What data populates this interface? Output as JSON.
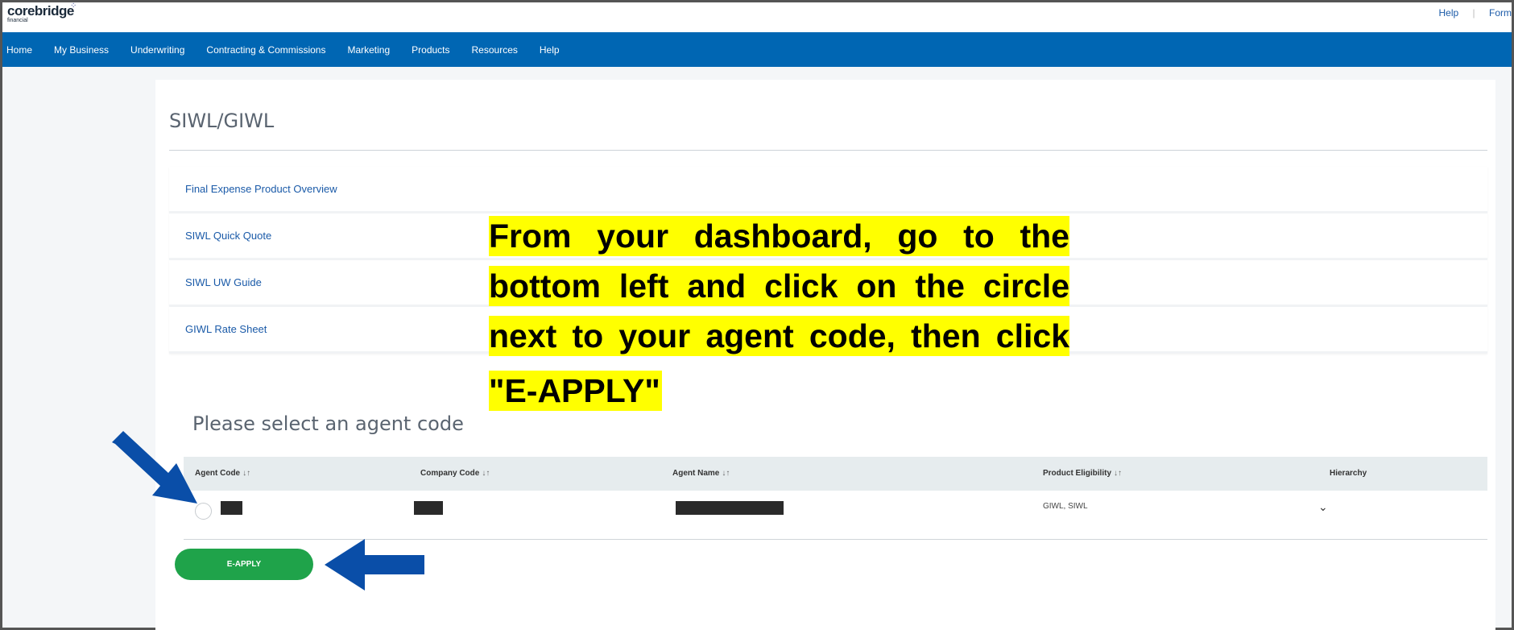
{
  "header": {
    "logo_text": "corebridge",
    "logo_sub": "financial",
    "top_links": [
      "Help",
      "Form"
    ]
  },
  "nav": {
    "items": [
      "Home",
      "My Business",
      "Underwriting",
      "Contracting & Commissions",
      "Marketing",
      "Products",
      "Resources",
      "Help"
    ]
  },
  "page": {
    "title": "SIWL/GIWL",
    "links": [
      "Final Expense Product Overview",
      "SIWL Quick Quote",
      "SIWL UW Guide",
      "GIWL Rate Sheet"
    ],
    "select_heading": "Please select an agent code"
  },
  "table": {
    "headers": {
      "agent_code": "Agent Code",
      "company_code": "Company Code",
      "agent_name": "Agent Name",
      "product_eligibility": "Product Eligibility",
      "hierarchy": "Hierarchy"
    },
    "sort_glyph": "↓↑",
    "row": {
      "product_eligibility": "GIWL, SIWL",
      "expand_glyph": "⌄"
    }
  },
  "actions": {
    "eapply_label": "E-APPLY"
  },
  "callout": {
    "lines": [
      "From your dashboard, go to the",
      "bottom left and click on the circle",
      "next to your agent code, then click",
      "\"E-APPLY\""
    ],
    "highlight_color": "#ffff00"
  },
  "colors": {
    "nav_bg": "#0066b3",
    "button": "#1fa34a",
    "arrow": "#0a4ea8",
    "link": "#1a5aa8"
  }
}
